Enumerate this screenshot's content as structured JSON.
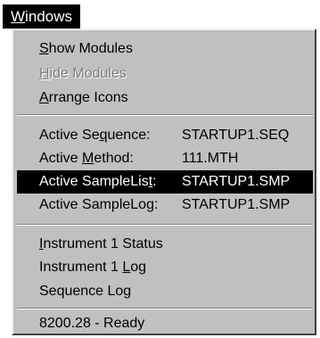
{
  "menubar": {
    "title_ul": "W",
    "title_rest": "indows"
  },
  "menu": {
    "show_modules": {
      "ul": "S",
      "rest": "how Modules"
    },
    "hide_modules": {
      "ul": "H",
      "rest": "ide Modules"
    },
    "arrange_icons": {
      "ul": "A",
      "rest": "rrange Icons"
    },
    "active_sequence": {
      "pre": "Active Se",
      "ul": "q",
      "post": "uence:",
      "value": "STARTUP1.SEQ"
    },
    "active_method": {
      "pre": "Active ",
      "ul": "M",
      "post": "ethod:",
      "value": "111.MTH"
    },
    "active_samplelist": {
      "pre": "Active SampleLis",
      "ul": "t",
      "post": ":",
      "value": "STARTUP1.SMP"
    },
    "active_samplelog": {
      "pre": "Active SampleLog:",
      "value": "STARTUP1.SMP"
    },
    "instrument_status": {
      "ul": "I",
      "rest": "nstrument 1 Status"
    },
    "instrument_log": {
      "pre": "Instrument 1 ",
      "ul": "L",
      "post": "og"
    },
    "sequence_log": {
      "label": "Sequence Log"
    },
    "status": {
      "label": "8200.28 - Ready"
    }
  },
  "colors": {
    "menu_bg": "#c0c0c0",
    "highlight_bg": "#000000",
    "highlight_fg": "#ffffff",
    "disabled_fg": "#808080"
  }
}
